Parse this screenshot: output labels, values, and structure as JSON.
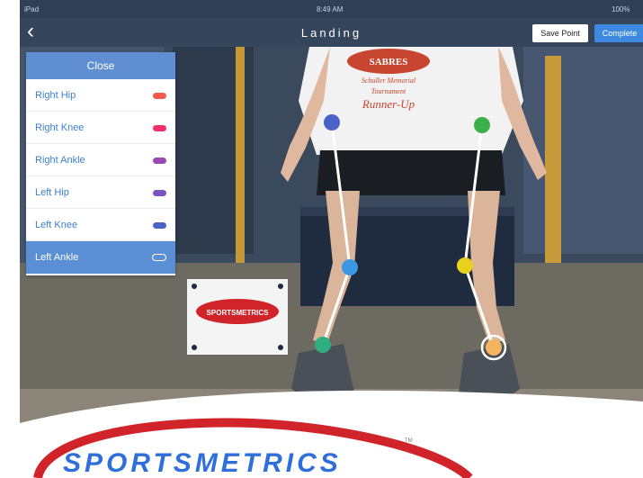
{
  "status": {
    "carrier": "iPad",
    "time": "8:49 AM",
    "battery": "100%"
  },
  "nav": {
    "title": "Landing",
    "save_label": "Save Point",
    "complete_label": "Complete"
  },
  "panel": {
    "close_label": "Close",
    "items": [
      {
        "label": "Right Hip",
        "color": "#f25a4a"
      },
      {
        "label": "Right Knee",
        "color": "#f0306a"
      },
      {
        "label": "Right Ankle",
        "color": "#9a48b4"
      },
      {
        "label": "Left Hip",
        "color": "#7a52c2"
      },
      {
        "label": "Left Knee",
        "color": "#4a63c8"
      },
      {
        "label": "Left Ankle",
        "color": "#ffffff"
      }
    ]
  },
  "markers": [
    {
      "name": "Right Hip",
      "color": "#4a63c8"
    },
    {
      "name": "Right Knee",
      "color": "#3d96e4"
    },
    {
      "name": "Right Ankle",
      "color": "#2fae82"
    },
    {
      "name": "Left Hip",
      "color": "#3bb04a"
    },
    {
      "name": "Left Knee",
      "color": "#e8d21c"
    },
    {
      "name": "Left Ankle",
      "color": "#f5b560"
    }
  ],
  "shirt": {
    "line1": "SABRES",
    "line2": "Schuller Memorial",
    "line3": "Tournament",
    "line4": "Runner-Up"
  },
  "sign": {
    "text": "SPORTSMETRICS"
  },
  "logo": {
    "text": "SPORTSMETRICS",
    "tm": "TM"
  }
}
